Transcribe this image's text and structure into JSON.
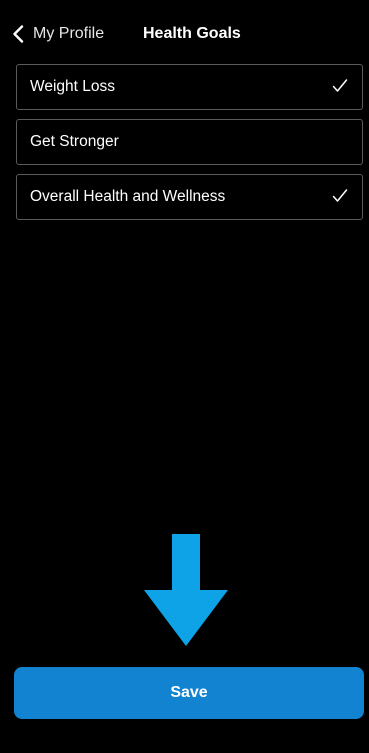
{
  "nav": {
    "back_label": "My Profile",
    "back_icon": "chevron-left-icon",
    "title": "Health Goals"
  },
  "goals": {
    "items": [
      {
        "label": "Weight Loss",
        "selected": true
      },
      {
        "label": "Get Stronger",
        "selected": false
      },
      {
        "label": "Overall Health and Wellness",
        "selected": true
      }
    ],
    "check_icon": "checkmark-icon"
  },
  "annotation": {
    "icon": "arrow-down-icon",
    "color": "#0ea3e6"
  },
  "actions": {
    "save_label": "Save",
    "save_color": "#1183d0"
  },
  "colors": {
    "background": "#000000",
    "text": "#ffffff",
    "item_border": "#5a5a5a"
  }
}
